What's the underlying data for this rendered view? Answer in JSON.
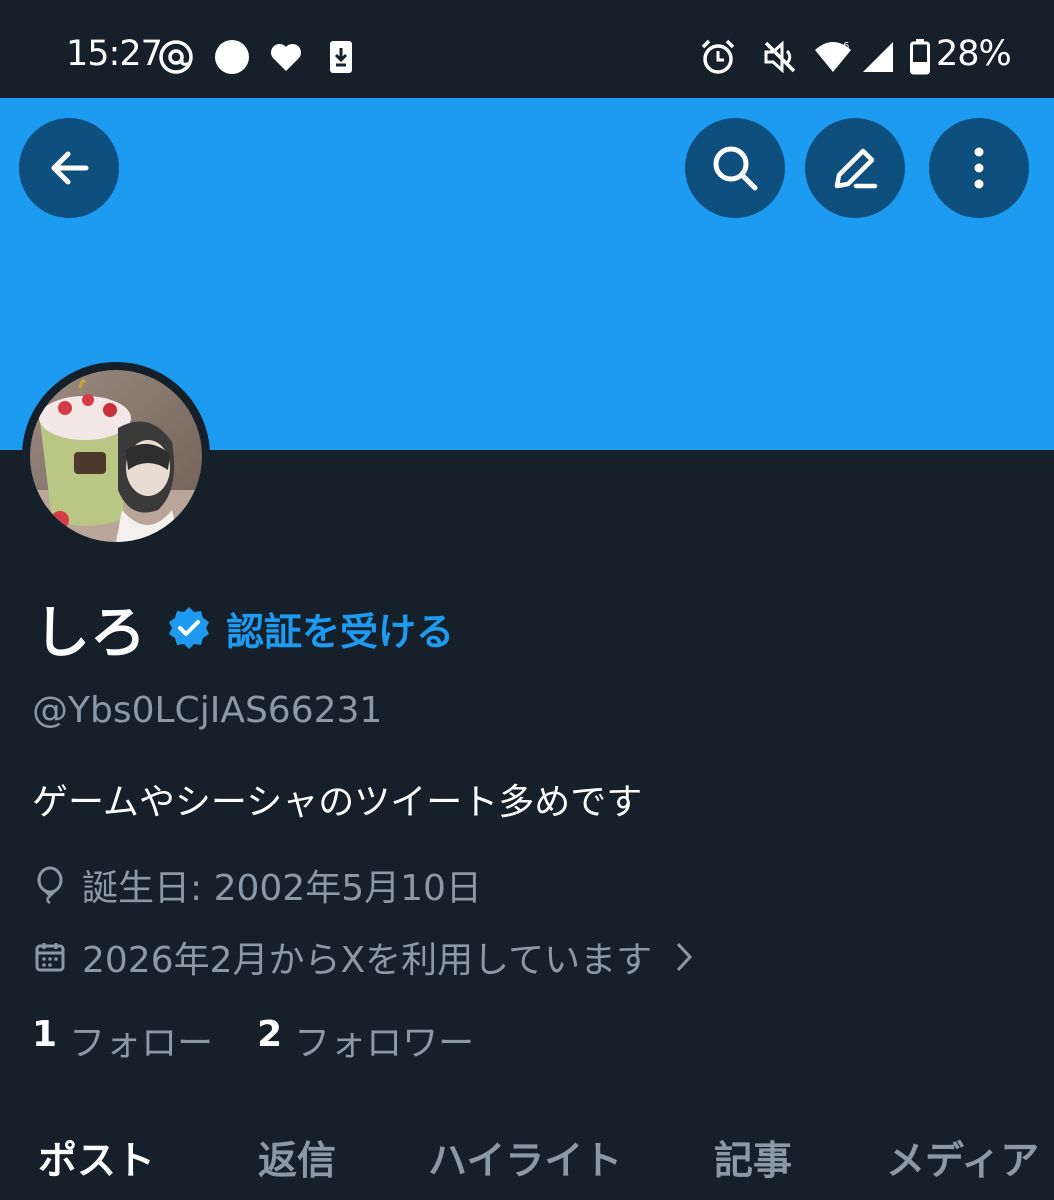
{
  "status_bar": {
    "time": "15:27",
    "battery": "28%",
    "icons": [
      "threads-icon",
      "circle-icon",
      "heart-icon",
      "download-icon",
      "alarm-icon",
      "mute-icon",
      "wifi-icon",
      "signal-icon",
      "battery-icon"
    ]
  },
  "header": {
    "banner_color": "#1d9bf0",
    "buttons": [
      "back-icon",
      "search-icon",
      "edit-icon",
      "more-icon"
    ]
  },
  "profile": {
    "display_name": "しろ",
    "verify_link": "認証を受ける",
    "handle": "@Ybs0LCjIAS66231",
    "bio": "ゲームやシーシャのツイート多めです",
    "birthday": "誕生日: 2002年5月10日",
    "joined": "2026年2月からXを利用しています",
    "following_count": "1",
    "following_label": "フォロー",
    "followers_count": "2",
    "followers_label": "フォロワー"
  },
  "tabs": [
    {
      "label": "ポスト",
      "active": true
    },
    {
      "label": "返信",
      "active": false
    },
    {
      "label": "ハイライト",
      "active": false
    },
    {
      "label": "記事",
      "active": false
    },
    {
      "label": "メディア",
      "active": false
    }
  ],
  "colors": {
    "background": "#15202b",
    "accent": "#1d9bf0",
    "secondary_text": "#8b98a5"
  }
}
